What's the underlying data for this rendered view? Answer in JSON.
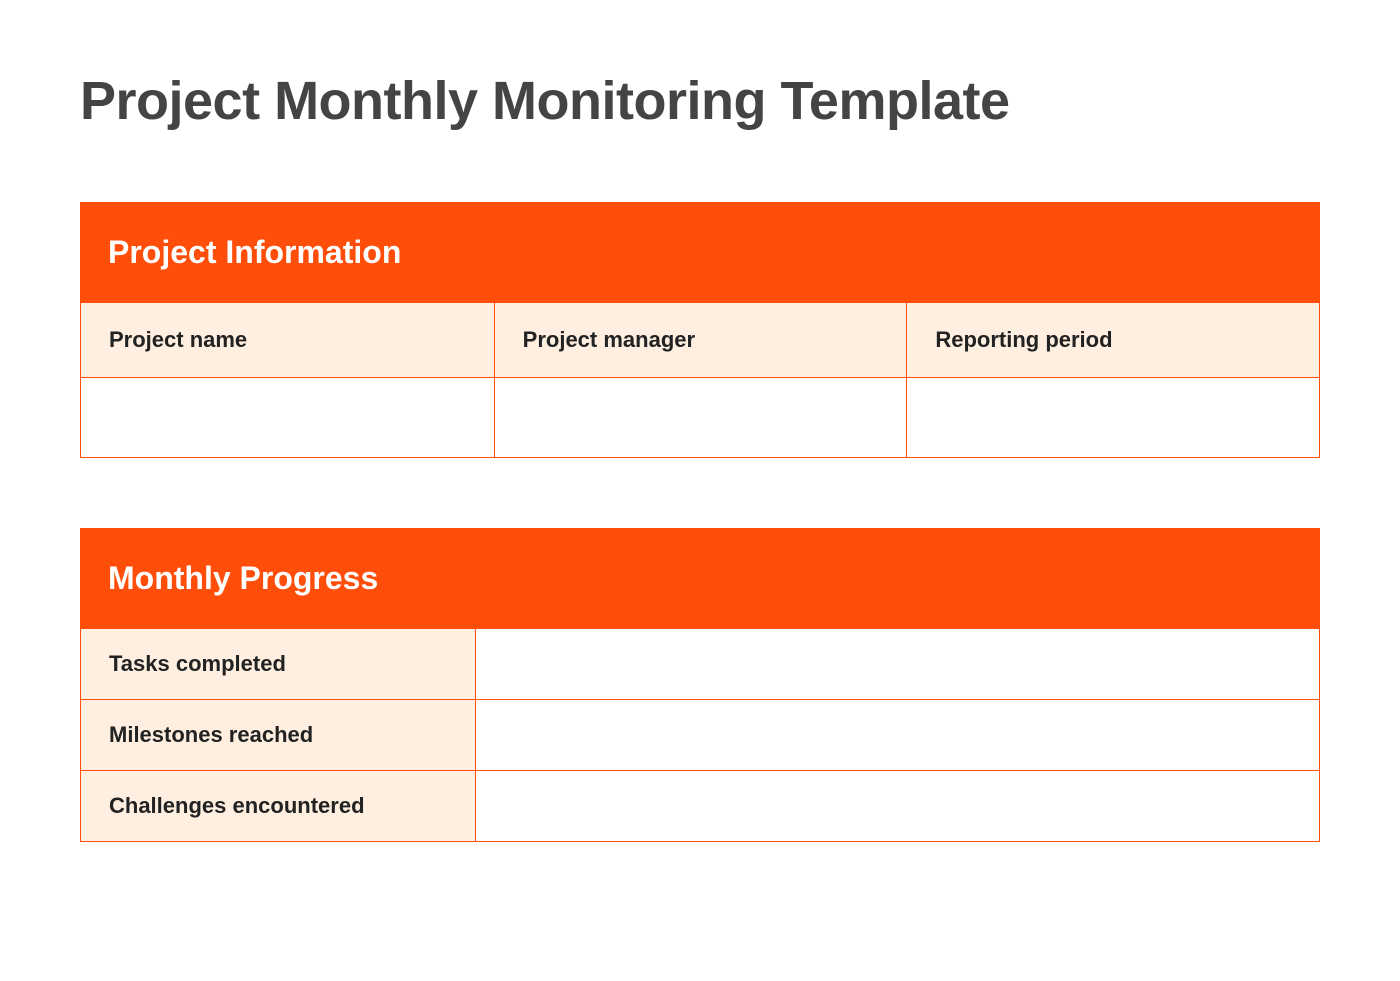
{
  "title": "Project Monthly Monitoring Template",
  "sections": {
    "project_info": {
      "header": "Project Information",
      "columns": {
        "project_name": {
          "label": "Project name",
          "value": ""
        },
        "project_manager": {
          "label": "Project manager",
          "value": ""
        },
        "reporting_period": {
          "label": "Reporting period",
          "value": ""
        }
      }
    },
    "monthly_progress": {
      "header": "Monthly Progress",
      "rows": {
        "tasks_completed": {
          "label": "Tasks completed",
          "value": ""
        },
        "milestones_reached": {
          "label": "Milestones reached",
          "value": ""
        },
        "challenges_encountered": {
          "label": "Challenges encountered",
          "value": ""
        }
      }
    }
  }
}
